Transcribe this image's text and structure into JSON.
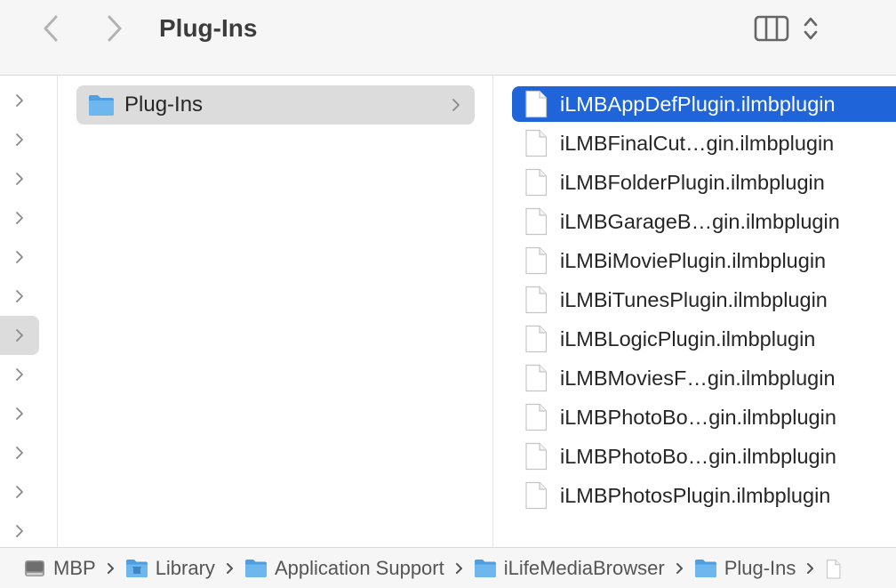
{
  "window": {
    "title": "Plug-Ins"
  },
  "toolbar": {
    "back_icon": "chevron-left-icon",
    "forward_icon": "chevron-right-icon",
    "view_icon": "column-view-icon",
    "view_options_icon": "chevron-up-down-icon"
  },
  "column1": {
    "rows": 12,
    "selected_index": 6
  },
  "column2": {
    "items": [
      {
        "label": "Plug-Ins",
        "icon": "folder-icon",
        "selected": true
      }
    ]
  },
  "column3": {
    "items": [
      {
        "label": "iLMBAppDefPlugin.ilmbplugin",
        "selected": true
      },
      {
        "label": "iLMBFinalCut…gin.ilmbplugin"
      },
      {
        "label": "iLMBFolderPlugin.ilmbplugin"
      },
      {
        "label": "iLMBGarageB…gin.ilmbplugin"
      },
      {
        "label": "iLMBiMoviePlugin.ilmbplugin"
      },
      {
        "label": "iLMBiTunesPlugin.ilmbplugin"
      },
      {
        "label": "iLMBLogicPlugin.ilmbplugin"
      },
      {
        "label": "iLMBMoviesF…gin.ilmbplugin"
      },
      {
        "label": "iLMBPhotoBo…gin.ilmbplugin"
      },
      {
        "label": "iLMBPhotoBo…gin.ilmbplugin"
      },
      {
        "label": "iLMBPhotosPlugin.ilmbplugin"
      }
    ]
  },
  "pathbar": {
    "crumbs": [
      {
        "label": "MBP",
        "icon": "hard-drive-icon"
      },
      {
        "label": "Library",
        "icon": "library-folder-icon"
      },
      {
        "label": "Application Support",
        "icon": "folder-icon"
      },
      {
        "label": "iLifeMediaBrowser",
        "icon": "folder-icon"
      },
      {
        "label": "Plug-Ins",
        "icon": "folder-icon"
      },
      {
        "label": "",
        "icon": "document-icon"
      }
    ]
  },
  "colors": {
    "selection": "#1f64d9",
    "folder": "#5aa9e6",
    "toolbar_bg": "#f6f6f6"
  }
}
